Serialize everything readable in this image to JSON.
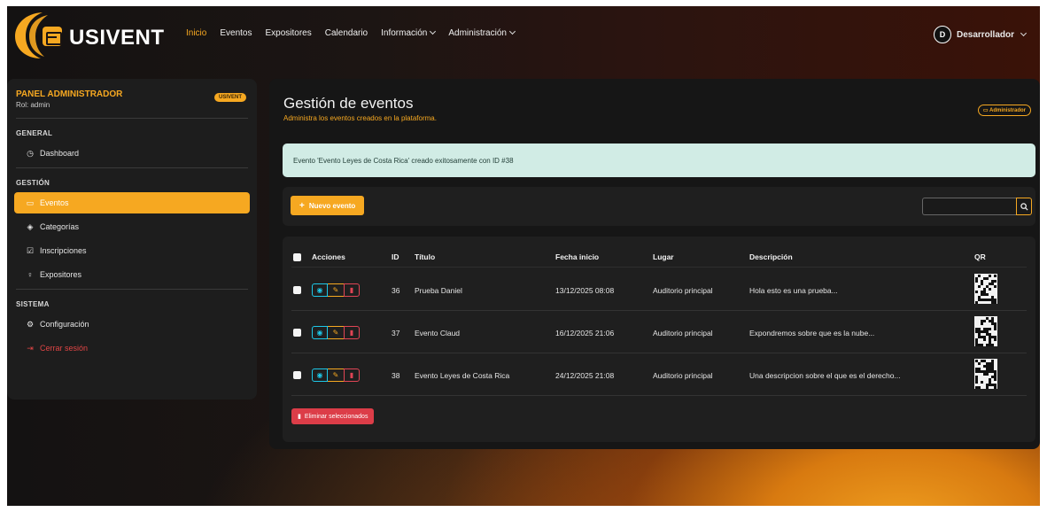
{
  "brand": {
    "name": "USIVENT"
  },
  "nav": [
    {
      "label": "Inicio",
      "active": true
    },
    {
      "label": "Eventos"
    },
    {
      "label": "Expositores"
    },
    {
      "label": "Calendario"
    },
    {
      "label": "Información",
      "dropdown": true
    },
    {
      "label": "Administración",
      "dropdown": true
    }
  ],
  "user": {
    "initial": "D",
    "name": "Desarrollador"
  },
  "sidebar": {
    "title": "PANEL ADMINISTRADOR",
    "role": "Rol: admin",
    "badge": "USIVENT",
    "sections": {
      "general": "GENERAL",
      "gestion": "GESTIÓN",
      "sistema": "SISTEMA"
    },
    "items": {
      "dashboard": "Dashboard",
      "eventos": "Eventos",
      "categorias": "Categorías",
      "inscripciones": "Inscripciones",
      "expositores": "Expositores",
      "configuracion": "Configuración",
      "logout": "Cerrar sesión"
    }
  },
  "main": {
    "title": "Gestión de eventos",
    "subtitle": "Administra los eventos creados en la plataforma.",
    "badge": "Administrador",
    "alert": "Evento 'Evento Leyes de Costa Rica' creado exitosamente con ID #38",
    "new_button": "Nuevo evento",
    "delete_selected": "Eliminar seleccionados"
  },
  "table": {
    "headers": {
      "acciones": "Acciones",
      "id": "ID",
      "titulo": "Título",
      "fecha": "Fecha inicio",
      "lugar": "Lugar",
      "descripcion": "Descripción",
      "qr": "QR"
    },
    "rows": [
      {
        "id": "36",
        "titulo": "Prueba Daniel",
        "fecha": "13/12/2025 08:08",
        "lugar": "Auditorio principal",
        "descripcion": "Hola esto es una prueba..."
      },
      {
        "id": "37",
        "titulo": "Evento Claud",
        "fecha": "16/12/2025 21:06",
        "lugar": "Auditorio principal",
        "descripcion": "Expondremos sobre que es la nube..."
      },
      {
        "id": "38",
        "titulo": "Evento Leyes de Costa Rica",
        "fecha": "24/12/2025 21:08",
        "lugar": "Auditorio principal",
        "descripcion": "Una descripcion sobre el que es el derecho..."
      }
    ]
  },
  "colors": {
    "accent": "#f6a821",
    "danger": "#dc3d48",
    "info": "#1ec8e8",
    "success_bg": "#d1ece5"
  }
}
